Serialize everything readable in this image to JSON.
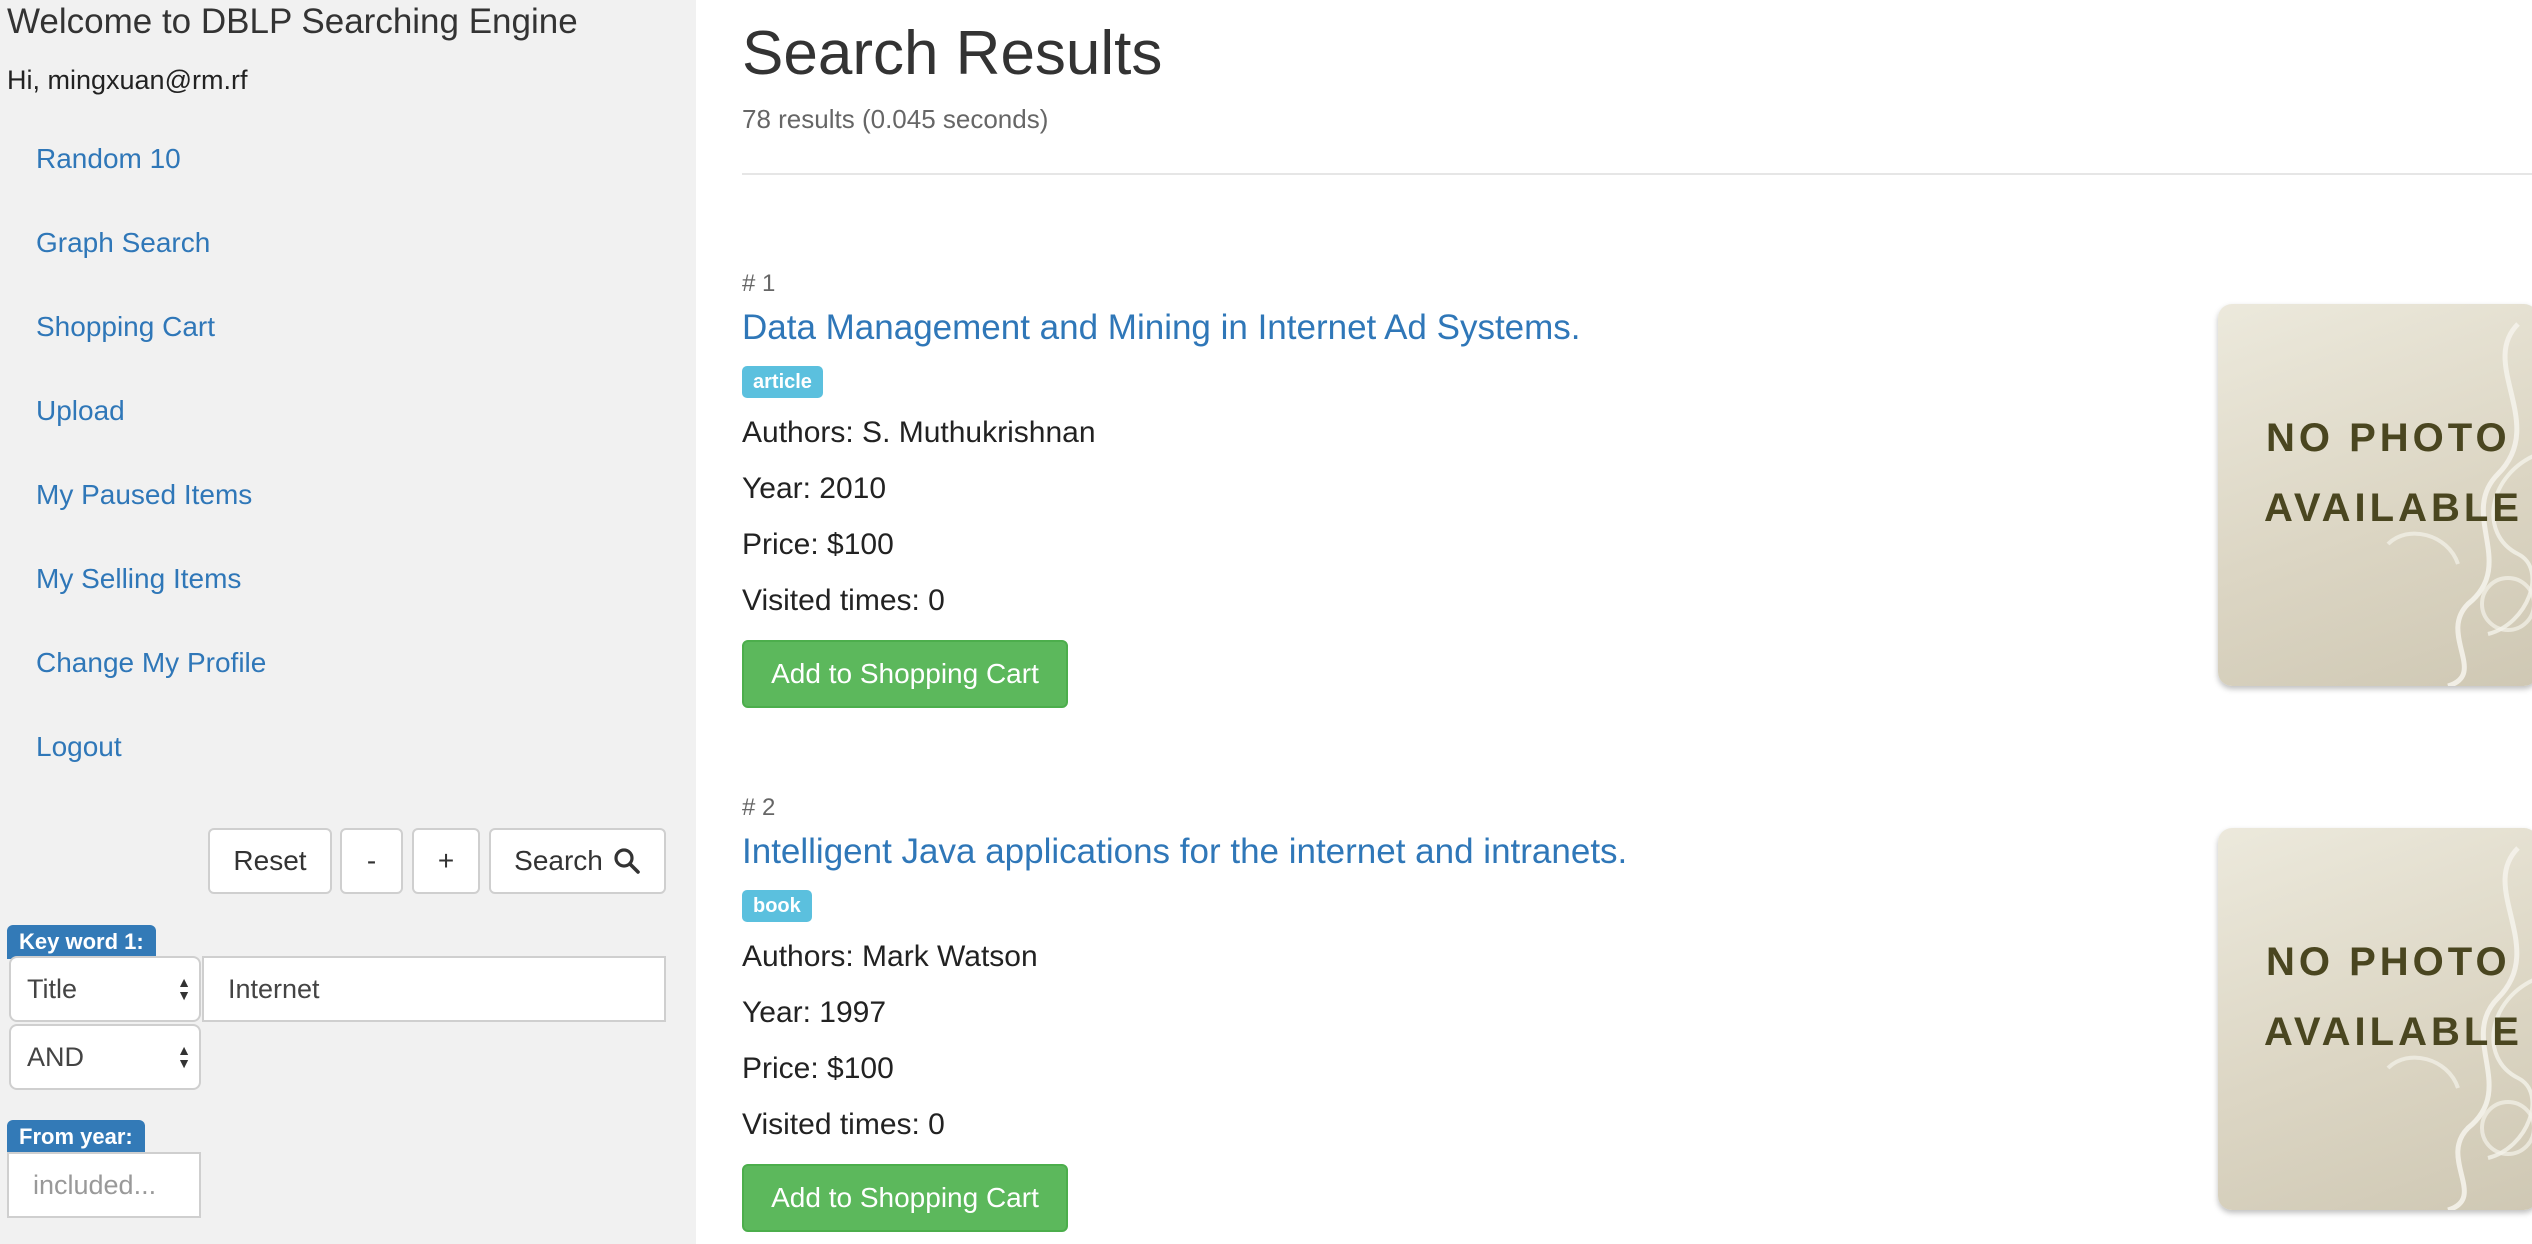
{
  "sidebar": {
    "site_title": "Welcome to DBLP Searching Engine",
    "greeting": "Hi, mingxuan@rm.rf",
    "nav": [
      {
        "label": "Random 10"
      },
      {
        "label": "Graph Search"
      },
      {
        "label": "Shopping Cart"
      },
      {
        "label": "Upload"
      },
      {
        "label": "My Paused Items"
      },
      {
        "label": "My Selling Items"
      },
      {
        "label": "Change My Profile"
      },
      {
        "label": "Logout"
      }
    ],
    "buttons": {
      "reset": "Reset",
      "minus": "-",
      "plus": "+",
      "search": "Search"
    },
    "keyword1": {
      "label": "Key word 1:",
      "field_select": "Title",
      "value": "Internet",
      "operator_select": "AND"
    },
    "from_year": {
      "label": "From year:",
      "placeholder": "included..."
    }
  },
  "main": {
    "title": "Search Results",
    "stats": "78 results (0.045 seconds)",
    "results": [
      {
        "num": "# 1",
        "title": "Data Management and Mining in Internet Ad Systems.",
        "type": "article",
        "authors": "Authors: S. Muthukrishnan",
        "year": "Year: 2010",
        "price": "Price: $100",
        "visited": "Visited times: 0",
        "button": "Add to Shopping Cart",
        "image_text": [
          "NO PHOTO",
          "AVAILABLE"
        ]
      },
      {
        "num": "# 2",
        "title": "Intelligent Java applications for the internet and intranets.",
        "type": "book",
        "authors": "Authors: Mark Watson",
        "year": "Year: 1997",
        "price": "Price: $100",
        "visited": "Visited times: 0",
        "button": "Add to Shopping Cart",
        "image_text": [
          "NO PHOTO",
          "AVAILABLE"
        ]
      }
    ]
  },
  "colors": {
    "link": "#2f77b8",
    "success": "#5cb85c",
    "info_badge": "#5bc0de",
    "label_primary": "#337ab7",
    "sidebar_bg": "#f1f1f1"
  },
  "icons": {
    "search_button": "magnifier-icon",
    "select": "updown-arrows-icon"
  }
}
